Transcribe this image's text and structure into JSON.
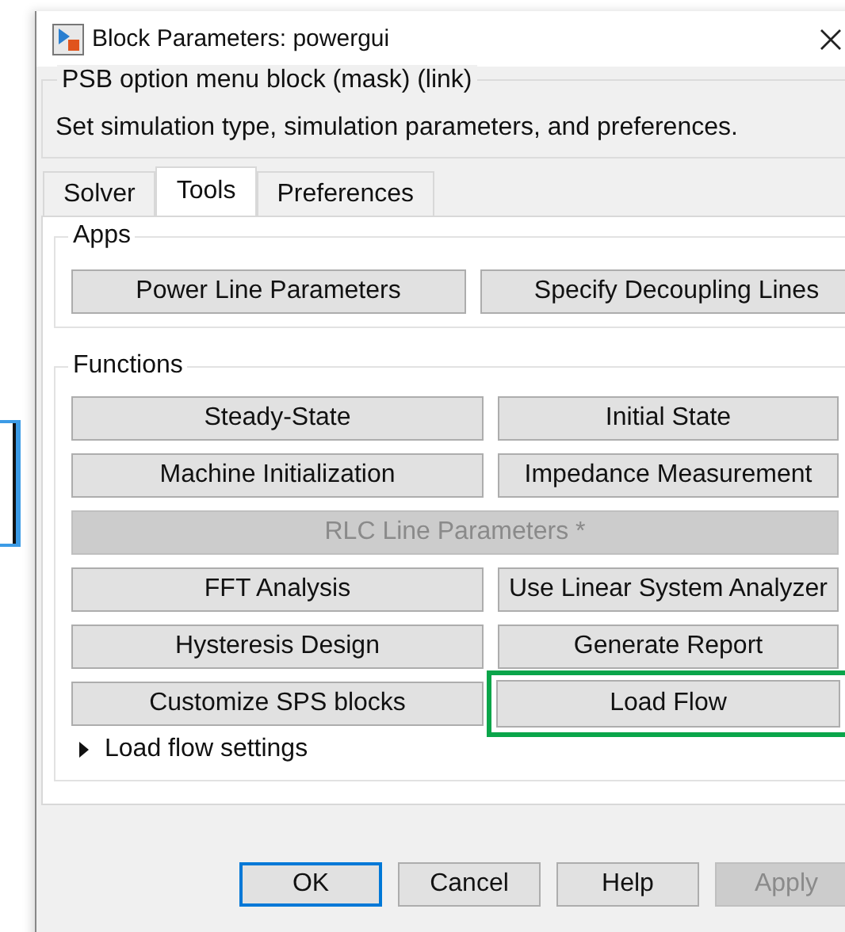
{
  "window": {
    "title": "Block Parameters: powergui"
  },
  "mask": {
    "title": "PSB option menu block (mask) (link)",
    "description": "Set simulation type, simulation parameters, and preferences."
  },
  "tabs": [
    {
      "label": "Solver",
      "selected": false
    },
    {
      "label": "Tools",
      "selected": true
    },
    {
      "label": "Preferences",
      "selected": false
    }
  ],
  "apps": {
    "label": "Apps",
    "buttons": [
      {
        "label": "Power Line Parameters"
      },
      {
        "label": "Specify Decoupling Lines"
      }
    ]
  },
  "functions": {
    "label": "Functions",
    "buttons": [
      {
        "label": "Steady-State",
        "disabled": false,
        "highlighted": false,
        "full_width": false
      },
      {
        "label": "Initial State",
        "disabled": false,
        "highlighted": false,
        "full_width": false
      },
      {
        "label": "Machine Initialization",
        "disabled": false,
        "highlighted": false,
        "full_width": false
      },
      {
        "label": "Impedance Measurement",
        "disabled": false,
        "highlighted": false,
        "full_width": false
      },
      {
        "label": "RLC Line Parameters *",
        "disabled": true,
        "highlighted": false,
        "full_width": true
      },
      {
        "label": "FFT Analysis",
        "disabled": false,
        "highlighted": false,
        "full_width": false
      },
      {
        "label": "Use Linear System Analyzer",
        "disabled": false,
        "highlighted": false,
        "full_width": false
      },
      {
        "label": "Hysteresis Design",
        "disabled": false,
        "highlighted": false,
        "full_width": false
      },
      {
        "label": "Generate Report",
        "disabled": false,
        "highlighted": false,
        "full_width": false
      },
      {
        "label": "Customize SPS blocks",
        "disabled": false,
        "highlighted": false,
        "full_width": false
      },
      {
        "label": "Load Flow",
        "disabled": false,
        "highlighted": true,
        "full_width": false
      }
    ],
    "settings": {
      "label": "Load flow settings",
      "expanded": false
    }
  },
  "buttons": [
    {
      "label": "OK",
      "default": true,
      "disabled": false
    },
    {
      "label": "Cancel",
      "default": false,
      "disabled": false
    },
    {
      "label": "Help",
      "default": false,
      "disabled": false
    },
    {
      "label": "Apply",
      "default": false,
      "disabled": true
    }
  ]
}
